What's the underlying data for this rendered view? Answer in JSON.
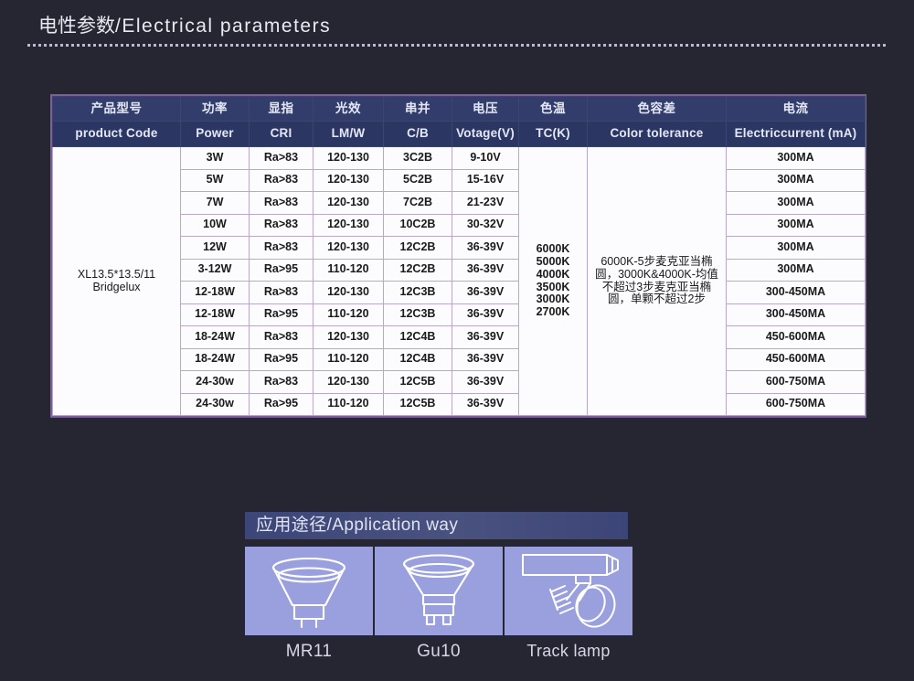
{
  "section": {
    "title_cn": "电性参数",
    "title_sep": "/",
    "title_en": "Electrical parameters"
  },
  "table": {
    "headers_cn": [
      "产品型号",
      "功率",
      "显指",
      "光效",
      "串并",
      "电压",
      "色温",
      "色容差",
      "电流"
    ],
    "headers_en": [
      "product Code",
      "Power",
      "CRI",
      "LM/W",
      "C/B",
      "Votage(V)",
      "TC(K)",
      "Color tolerance",
      "Electriccurrent (mA)"
    ],
    "product_code": "XL13.5*13.5/11\nBridgelux",
    "product_code_line1": "XL13.5*13.5/11",
    "product_code_line2": "Bridgelux",
    "color_temp": "6000K\n5000K\n4000K\n3500K\n3000K\n2700K",
    "color_tolerance": "6000K-5步麦克亚当椭圆，3000K&4000K-均值不超过3步麦克亚当椭圆，单颗不超过2步",
    "rows": [
      {
        "power": "3W",
        "cri": "Ra>83",
        "lmw": "120-130",
        "cb": "3C2B",
        "voltage": "9-10V",
        "current": "300MA"
      },
      {
        "power": "5W",
        "cri": "Ra>83",
        "lmw": "120-130",
        "cb": "5C2B",
        "voltage": "15-16V",
        "current": "300MA"
      },
      {
        "power": "7W",
        "cri": "Ra>83",
        "lmw": "120-130",
        "cb": "7C2B",
        "voltage": "21-23V",
        "current": "300MA"
      },
      {
        "power": "10W",
        "cri": "Ra>83",
        "lmw": "120-130",
        "cb": "10C2B",
        "voltage": "30-32V",
        "current": "300MA"
      },
      {
        "power": "12W",
        "cri": "Ra>83",
        "lmw": "120-130",
        "cb": "12C2B",
        "voltage": "36-39V",
        "current": "300MA"
      },
      {
        "power": "3-12W",
        "cri": "Ra>95",
        "lmw": "110-120",
        "cb": "12C2B",
        "voltage": "36-39V",
        "current": "300MA"
      },
      {
        "power": "12-18W",
        "cri": "Ra>83",
        "lmw": "120-130",
        "cb": "12C3B",
        "voltage": "36-39V",
        "current": "300-450MA"
      },
      {
        "power": "12-18W",
        "cri": "Ra>95",
        "lmw": "110-120",
        "cb": "12C3B",
        "voltage": "36-39V",
        "current": "300-450MA"
      },
      {
        "power": "18-24W",
        "cri": "Ra>83",
        "lmw": "120-130",
        "cb": "12C4B",
        "voltage": "36-39V",
        "current": "450-600MA"
      },
      {
        "power": "18-24W",
        "cri": "Ra>95",
        "lmw": "110-120",
        "cb": "12C4B",
        "voltage": "36-39V",
        "current": "450-600MA"
      },
      {
        "power": "24-30w",
        "cri": "Ra>83",
        "lmw": "120-130",
        "cb": "12C5B",
        "voltage": "36-39V",
        "current": "600-750MA"
      },
      {
        "power": "24-30w",
        "cri": "Ra>95",
        "lmw": "110-120",
        "cb": "12C5B",
        "voltage": "36-39V",
        "current": "600-750MA"
      }
    ]
  },
  "application": {
    "header_cn": "应用途径",
    "header_sep": "/",
    "header_en": "Application way",
    "header_full": "应用途径/Application way",
    "items": [
      {
        "label": "MR11",
        "icon": "mr11-bulb-icon"
      },
      {
        "label": "Gu10",
        "icon": "gu10-bulb-icon"
      },
      {
        "label": "Track lamp",
        "icon": "track-lamp-icon"
      }
    ]
  },
  "colors": {
    "background": "#262633",
    "header_row_cn": "#333d6b",
    "header_row_en": "#2c3663",
    "table_border": "#7d5fa0",
    "cell_border": "#b9a8cc",
    "thumb_bg": "#9aa0dd",
    "title_text": "#e9e9f2"
  }
}
